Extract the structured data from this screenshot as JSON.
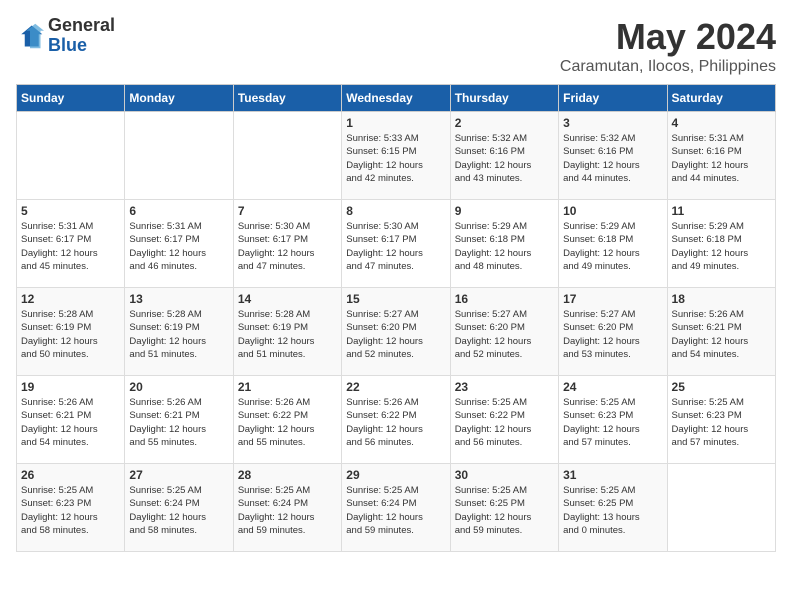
{
  "logo": {
    "general": "General",
    "blue": "Blue"
  },
  "title": "May 2024",
  "subtitle": "Caramutan, Ilocos, Philippines",
  "days_of_week": [
    "Sunday",
    "Monday",
    "Tuesday",
    "Wednesday",
    "Thursday",
    "Friday",
    "Saturday"
  ],
  "weeks": [
    [
      {
        "day": "",
        "info": ""
      },
      {
        "day": "",
        "info": ""
      },
      {
        "day": "",
        "info": ""
      },
      {
        "day": "1",
        "info": "Sunrise: 5:33 AM\nSunset: 6:15 PM\nDaylight: 12 hours\nand 42 minutes."
      },
      {
        "day": "2",
        "info": "Sunrise: 5:32 AM\nSunset: 6:16 PM\nDaylight: 12 hours\nand 43 minutes."
      },
      {
        "day": "3",
        "info": "Sunrise: 5:32 AM\nSunset: 6:16 PM\nDaylight: 12 hours\nand 44 minutes."
      },
      {
        "day": "4",
        "info": "Sunrise: 5:31 AM\nSunset: 6:16 PM\nDaylight: 12 hours\nand 44 minutes."
      }
    ],
    [
      {
        "day": "5",
        "info": "Sunrise: 5:31 AM\nSunset: 6:17 PM\nDaylight: 12 hours\nand 45 minutes."
      },
      {
        "day": "6",
        "info": "Sunrise: 5:31 AM\nSunset: 6:17 PM\nDaylight: 12 hours\nand 46 minutes."
      },
      {
        "day": "7",
        "info": "Sunrise: 5:30 AM\nSunset: 6:17 PM\nDaylight: 12 hours\nand 47 minutes."
      },
      {
        "day": "8",
        "info": "Sunrise: 5:30 AM\nSunset: 6:17 PM\nDaylight: 12 hours\nand 47 minutes."
      },
      {
        "day": "9",
        "info": "Sunrise: 5:29 AM\nSunset: 6:18 PM\nDaylight: 12 hours\nand 48 minutes."
      },
      {
        "day": "10",
        "info": "Sunrise: 5:29 AM\nSunset: 6:18 PM\nDaylight: 12 hours\nand 49 minutes."
      },
      {
        "day": "11",
        "info": "Sunrise: 5:29 AM\nSunset: 6:18 PM\nDaylight: 12 hours\nand 49 minutes."
      }
    ],
    [
      {
        "day": "12",
        "info": "Sunrise: 5:28 AM\nSunset: 6:19 PM\nDaylight: 12 hours\nand 50 minutes."
      },
      {
        "day": "13",
        "info": "Sunrise: 5:28 AM\nSunset: 6:19 PM\nDaylight: 12 hours\nand 51 minutes."
      },
      {
        "day": "14",
        "info": "Sunrise: 5:28 AM\nSunset: 6:19 PM\nDaylight: 12 hours\nand 51 minutes."
      },
      {
        "day": "15",
        "info": "Sunrise: 5:27 AM\nSunset: 6:20 PM\nDaylight: 12 hours\nand 52 minutes."
      },
      {
        "day": "16",
        "info": "Sunrise: 5:27 AM\nSunset: 6:20 PM\nDaylight: 12 hours\nand 52 minutes."
      },
      {
        "day": "17",
        "info": "Sunrise: 5:27 AM\nSunset: 6:20 PM\nDaylight: 12 hours\nand 53 minutes."
      },
      {
        "day": "18",
        "info": "Sunrise: 5:26 AM\nSunset: 6:21 PM\nDaylight: 12 hours\nand 54 minutes."
      }
    ],
    [
      {
        "day": "19",
        "info": "Sunrise: 5:26 AM\nSunset: 6:21 PM\nDaylight: 12 hours\nand 54 minutes."
      },
      {
        "day": "20",
        "info": "Sunrise: 5:26 AM\nSunset: 6:21 PM\nDaylight: 12 hours\nand 55 minutes."
      },
      {
        "day": "21",
        "info": "Sunrise: 5:26 AM\nSunset: 6:22 PM\nDaylight: 12 hours\nand 55 minutes."
      },
      {
        "day": "22",
        "info": "Sunrise: 5:26 AM\nSunset: 6:22 PM\nDaylight: 12 hours\nand 56 minutes."
      },
      {
        "day": "23",
        "info": "Sunrise: 5:25 AM\nSunset: 6:22 PM\nDaylight: 12 hours\nand 56 minutes."
      },
      {
        "day": "24",
        "info": "Sunrise: 5:25 AM\nSunset: 6:23 PM\nDaylight: 12 hours\nand 57 minutes."
      },
      {
        "day": "25",
        "info": "Sunrise: 5:25 AM\nSunset: 6:23 PM\nDaylight: 12 hours\nand 57 minutes."
      }
    ],
    [
      {
        "day": "26",
        "info": "Sunrise: 5:25 AM\nSunset: 6:23 PM\nDaylight: 12 hours\nand 58 minutes."
      },
      {
        "day": "27",
        "info": "Sunrise: 5:25 AM\nSunset: 6:24 PM\nDaylight: 12 hours\nand 58 minutes."
      },
      {
        "day": "28",
        "info": "Sunrise: 5:25 AM\nSunset: 6:24 PM\nDaylight: 12 hours\nand 59 minutes."
      },
      {
        "day": "29",
        "info": "Sunrise: 5:25 AM\nSunset: 6:24 PM\nDaylight: 12 hours\nand 59 minutes."
      },
      {
        "day": "30",
        "info": "Sunrise: 5:25 AM\nSunset: 6:25 PM\nDaylight: 12 hours\nand 59 minutes."
      },
      {
        "day": "31",
        "info": "Sunrise: 5:25 AM\nSunset: 6:25 PM\nDaylight: 13 hours\nand 0 minutes."
      },
      {
        "day": "",
        "info": ""
      }
    ]
  ]
}
